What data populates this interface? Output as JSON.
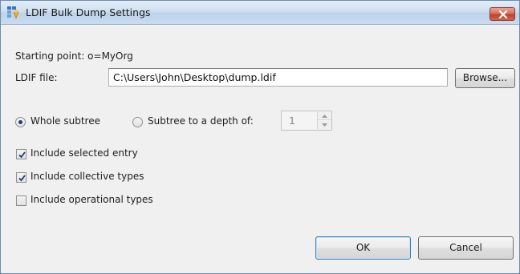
{
  "window": {
    "title": "LDIF Bulk Dump Settings"
  },
  "starting_point": {
    "label": "Starting point:",
    "value": "o=MyOrg"
  },
  "ldif_file": {
    "label": "LDIF file:",
    "value": "C:\\Users\\John\\Desktop\\dump.ldif",
    "browse_label": "Browse..."
  },
  "scope": {
    "whole_subtree_label": "Whole subtree",
    "whole_subtree_selected": true,
    "depth_label": "Subtree to a depth of:",
    "depth_selected": false,
    "depth_value": "1"
  },
  "options": {
    "include_selected_entry": {
      "label": "Include selected entry",
      "checked": true
    },
    "include_collective_types": {
      "label": "Include collective types",
      "checked": true
    },
    "include_operational_types": {
      "label": "Include operational types",
      "checked": false
    }
  },
  "buttons": {
    "ok_label": "OK",
    "cancel_label": "Cancel"
  },
  "colors": {
    "titlebar": "#cfdff0",
    "close_button": "#c0432a",
    "dialog_background": "#f0f0f0",
    "check_mark": "#1f3d6e"
  },
  "icons": {
    "title": "ldif-app-icon",
    "close": "close-icon"
  }
}
